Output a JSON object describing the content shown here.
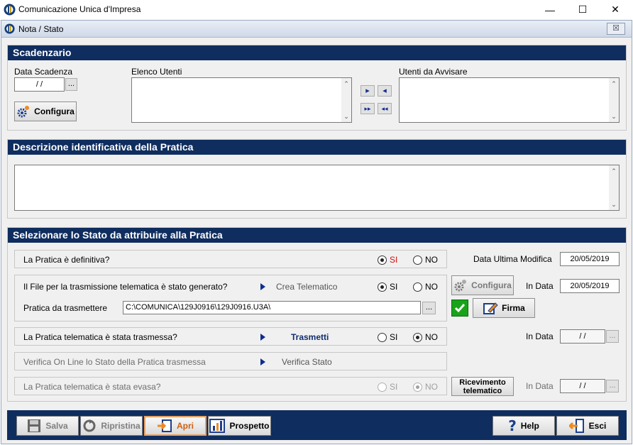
{
  "window": {
    "title": "Comunicazione Unica d'Impresa",
    "min_glyph": "—",
    "max_glyph": "☐",
    "close_glyph": "✕"
  },
  "inner": {
    "title": "Nota / Stato",
    "close_glyph": "☒"
  },
  "scadenzario": {
    "header": "Scadenzario",
    "data_scadenza_label": "Data Scadenza",
    "data_scadenza_value": "/ /",
    "ellipsis": "...",
    "configura_label": "Configura",
    "elenco_utenti_label": "Elenco Utenti",
    "utenti_avvisare_label": "Utenti da Avvisare",
    "move_right": "▸",
    "move_left": "◂",
    "move_all_right": "▸▸",
    "move_all_left": "◂◂"
  },
  "descrizione": {
    "header": "Descrizione identificativa della Pratica"
  },
  "stato": {
    "header": "Selezionare lo Stato da attribuire alla Pratica",
    "si": "SI",
    "no": "NO",
    "row1": {
      "label": "La Pratica è definitiva?",
      "selected": "SI"
    },
    "data_ultima_modifica_label": "Data Ultima Modifica",
    "data_ultima_modifica": "20/05/2019",
    "row2": {
      "label": "Il File per la trasmissione telematica è stato generato?",
      "action": "Crea Telematico",
      "selected": "SI"
    },
    "configura_label": "Configura",
    "in_data_label": "In Data",
    "row2_in_data": "20/05/2019",
    "pratica_trasmettere_label": "Pratica da trasmettere",
    "pratica_path": "C:\\COMUNICA\\129J0916\\129J0916.U3A\\",
    "firma_label": "Firma",
    "row3": {
      "label": "La Pratica telematica è stata trasmessa?",
      "action": "Trasmetti",
      "selected": "NO"
    },
    "row3_in_data": "/ /",
    "row4": {
      "label": "Verifica On Line lo Stato della Pratica trasmessa",
      "action": "Verifica Stato"
    },
    "row5": {
      "label": "La Pratica telematica è stata evasa?",
      "selected": "NO"
    },
    "ricevimento_label_1": "Ricevimento",
    "ricevimento_label_2": "telematico",
    "row5_in_data": "/ /"
  },
  "bottom": {
    "salva": "Salva",
    "ripristina": "Ripristina",
    "apri": "Apri",
    "prospetto": "Prospetto",
    "help": "Help",
    "esci": "Esci"
  }
}
